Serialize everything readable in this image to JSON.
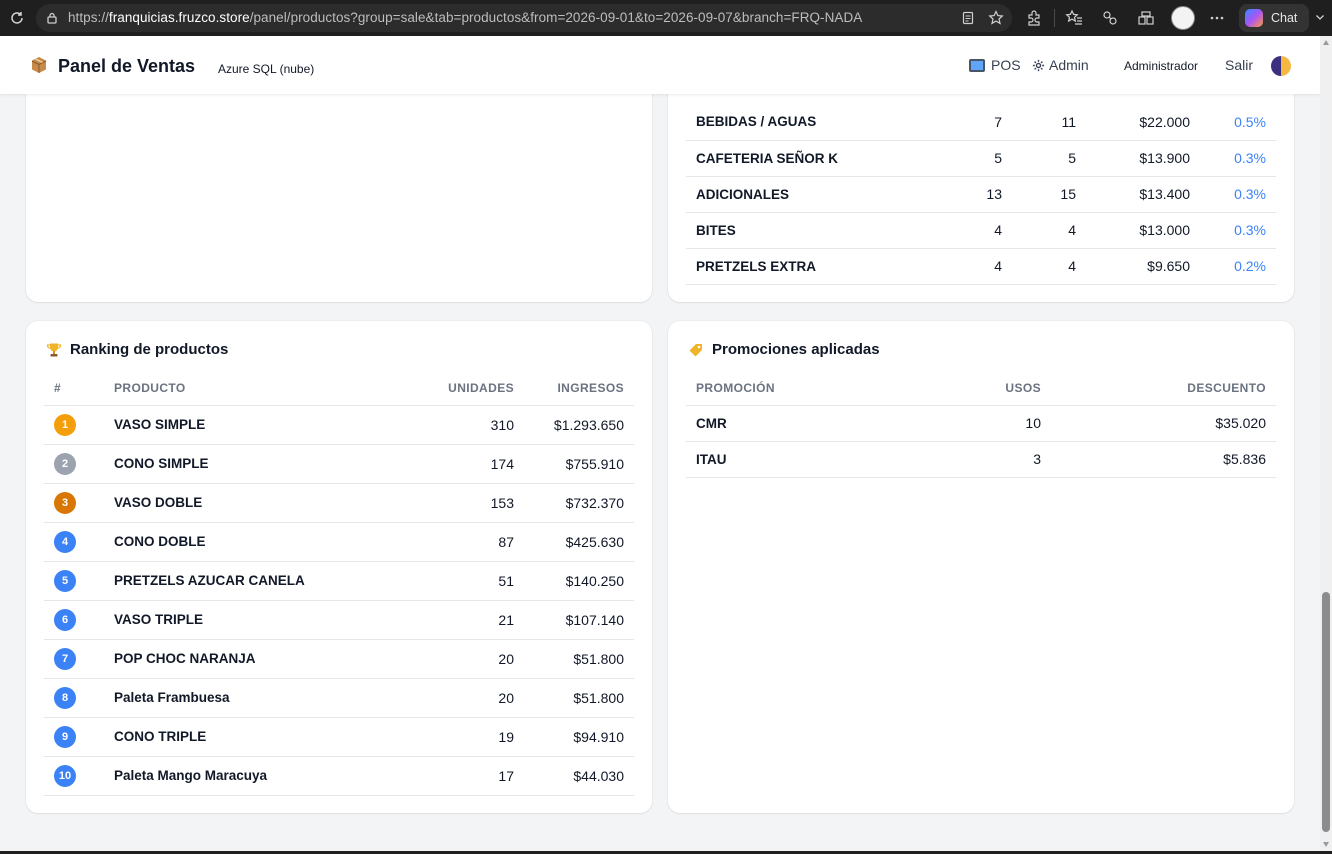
{
  "browser": {
    "url_scheme": "https://",
    "url_host": "franquicias.fruzco.store",
    "url_path": "/panel/productos?group=sale&tab=productos&from=2026-09-01&to=2026-09-07&branch=FRQ-NADA",
    "chat_label": "Chat"
  },
  "header": {
    "title": "Panel de Ventas",
    "subtitle": "Azure SQL (nube)",
    "nav_pos": "POS",
    "nav_admin": "Admin",
    "user": "Administrador",
    "logout": "Salir"
  },
  "categories_table": {
    "rows": [
      {
        "name": "BEBIDAS / AGUAS",
        "c1": "7",
        "c2": "11",
        "total": "$22.000",
        "pct": "0.5%"
      },
      {
        "name": "CAFETERIA SEÑOR K",
        "c1": "5",
        "c2": "5",
        "total": "$13.900",
        "pct": "0.3%"
      },
      {
        "name": "ADICIONALES",
        "c1": "13",
        "c2": "15",
        "total": "$13.400",
        "pct": "0.3%"
      },
      {
        "name": "BITES",
        "c1": "4",
        "c2": "4",
        "total": "$13.000",
        "pct": "0.3%"
      },
      {
        "name": "PRETZELS EXTRA",
        "c1": "4",
        "c2": "4",
        "total": "$9.650",
        "pct": "0.2%"
      }
    ]
  },
  "ranking": {
    "title": "Ranking de productos",
    "headers": {
      "num": "#",
      "product": "PRODUCTO",
      "units": "UNIDADES",
      "revenue": "INGRESOS"
    },
    "rows": [
      {
        "rank": "1",
        "product": "VASO SIMPLE",
        "units": "310",
        "revenue": "$1.293.650"
      },
      {
        "rank": "2",
        "product": "CONO SIMPLE",
        "units": "174",
        "revenue": "$755.910"
      },
      {
        "rank": "3",
        "product": "VASO DOBLE",
        "units": "153",
        "revenue": "$732.370"
      },
      {
        "rank": "4",
        "product": "CONO DOBLE",
        "units": "87",
        "revenue": "$425.630"
      },
      {
        "rank": "5",
        "product": "PRETZELS AZUCAR CANELA",
        "units": "51",
        "revenue": "$140.250"
      },
      {
        "rank": "6",
        "product": "VASO TRIPLE",
        "units": "21",
        "revenue": "$107.140"
      },
      {
        "rank": "7",
        "product": "POP CHOC NARANJA",
        "units": "20",
        "revenue": "$51.800"
      },
      {
        "rank": "8",
        "product": "Paleta Frambuesa",
        "units": "20",
        "revenue": "$51.800"
      },
      {
        "rank": "9",
        "product": "CONO TRIPLE",
        "units": "19",
        "revenue": "$94.910"
      },
      {
        "rank": "10",
        "product": "Paleta Mango Maracuya",
        "units": "17",
        "revenue": "$44.030"
      }
    ],
    "badge_colors": {
      "gold": "#f59e0b",
      "silver": "#9ca3af",
      "bronze": "#d97706",
      "default": "#3b82f6"
    }
  },
  "promotions": {
    "title": "Promociones aplicadas",
    "headers": {
      "promo": "PROMOCIÓN",
      "uses": "USOS",
      "discount": "DESCUENTO"
    },
    "rows": [
      {
        "promo": "CMR",
        "uses": "10",
        "discount": "$35.020"
      },
      {
        "promo": "ITAU",
        "uses": "3",
        "discount": "$5.836"
      }
    ]
  },
  "colors": {
    "accent": "#3b82f6",
    "page_bg": "#f3f4f6"
  }
}
